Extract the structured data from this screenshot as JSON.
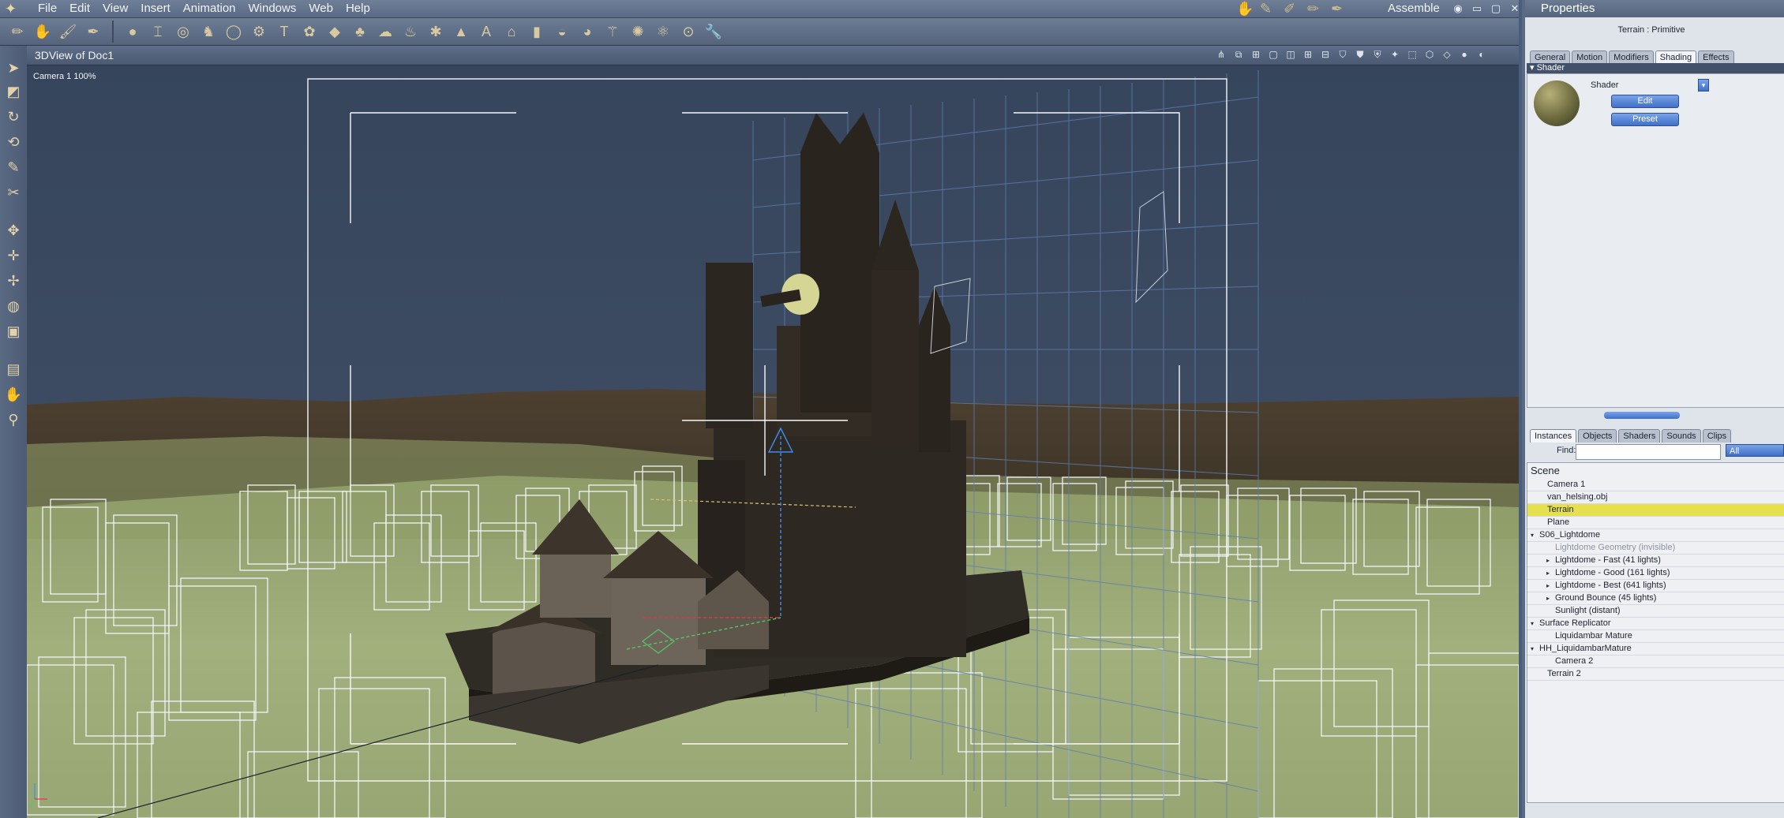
{
  "menubar": {
    "items": [
      "File",
      "Edit",
      "View",
      "Insert",
      "Animation",
      "Windows",
      "Web",
      "Help"
    ],
    "room": "Assemble"
  },
  "viewport": {
    "title": "3DView of Doc1",
    "camera_label": "Camera 1 100%"
  },
  "properties": {
    "title": "Properties",
    "object": "Terrain : Primitive",
    "tabs": [
      "General",
      "Motion",
      "Modifiers",
      "Shading",
      "Effects"
    ],
    "active_tab": "Shading",
    "section": "Shader",
    "shader_label": "Shader",
    "edit_label": "Edit",
    "preset_label": "Preset"
  },
  "browser": {
    "tabs": [
      "Instances",
      "Objects",
      "Shaders",
      "Sounds",
      "Clips"
    ],
    "active_tab": "Instances",
    "find_label": "Find:",
    "find_value": "",
    "filter_value": "All",
    "root": "Scene",
    "items": [
      {
        "label": "Camera 1",
        "indent": 1,
        "state": "normal"
      },
      {
        "label": "van_helsing.obj",
        "indent": 1,
        "state": "normal"
      },
      {
        "label": "Terrain",
        "indent": 1,
        "state": "selected"
      },
      {
        "label": "Plane",
        "indent": 1,
        "state": "normal"
      },
      {
        "label": "S06_Lightdome",
        "indent": 0,
        "state": "expanded"
      },
      {
        "label": "Lightdome Geometry (invisible)",
        "indent": 2,
        "state": "dim"
      },
      {
        "label": "Lightdome - Fast (41 lights)",
        "indent": 2,
        "state": "collapsed"
      },
      {
        "label": "Lightdome - Good (161 lights)",
        "indent": 2,
        "state": "collapsed"
      },
      {
        "label": "Lightdome - Best (641 lights)",
        "indent": 2,
        "state": "collapsed"
      },
      {
        "label": "Ground Bounce (45 lights)",
        "indent": 2,
        "state": "collapsed"
      },
      {
        "label": "Sunlight (distant)",
        "indent": 2,
        "state": "normal"
      },
      {
        "label": "Surface Replicator",
        "indent": 0,
        "state": "expanded"
      },
      {
        "label": "Liquidambar Mature",
        "indent": 2,
        "state": "normal"
      },
      {
        "label": "HH_LiquidambarMature",
        "indent": 0,
        "state": "expanded"
      },
      {
        "label": "Camera 2",
        "indent": 2,
        "state": "normal"
      },
      {
        "label": "Terrain 2",
        "indent": 1,
        "state": "normal"
      }
    ]
  },
  "colors": {
    "sky": "#3c4b61",
    "ground": "#9aa874",
    "selection_highlight": "#e6e04e"
  }
}
